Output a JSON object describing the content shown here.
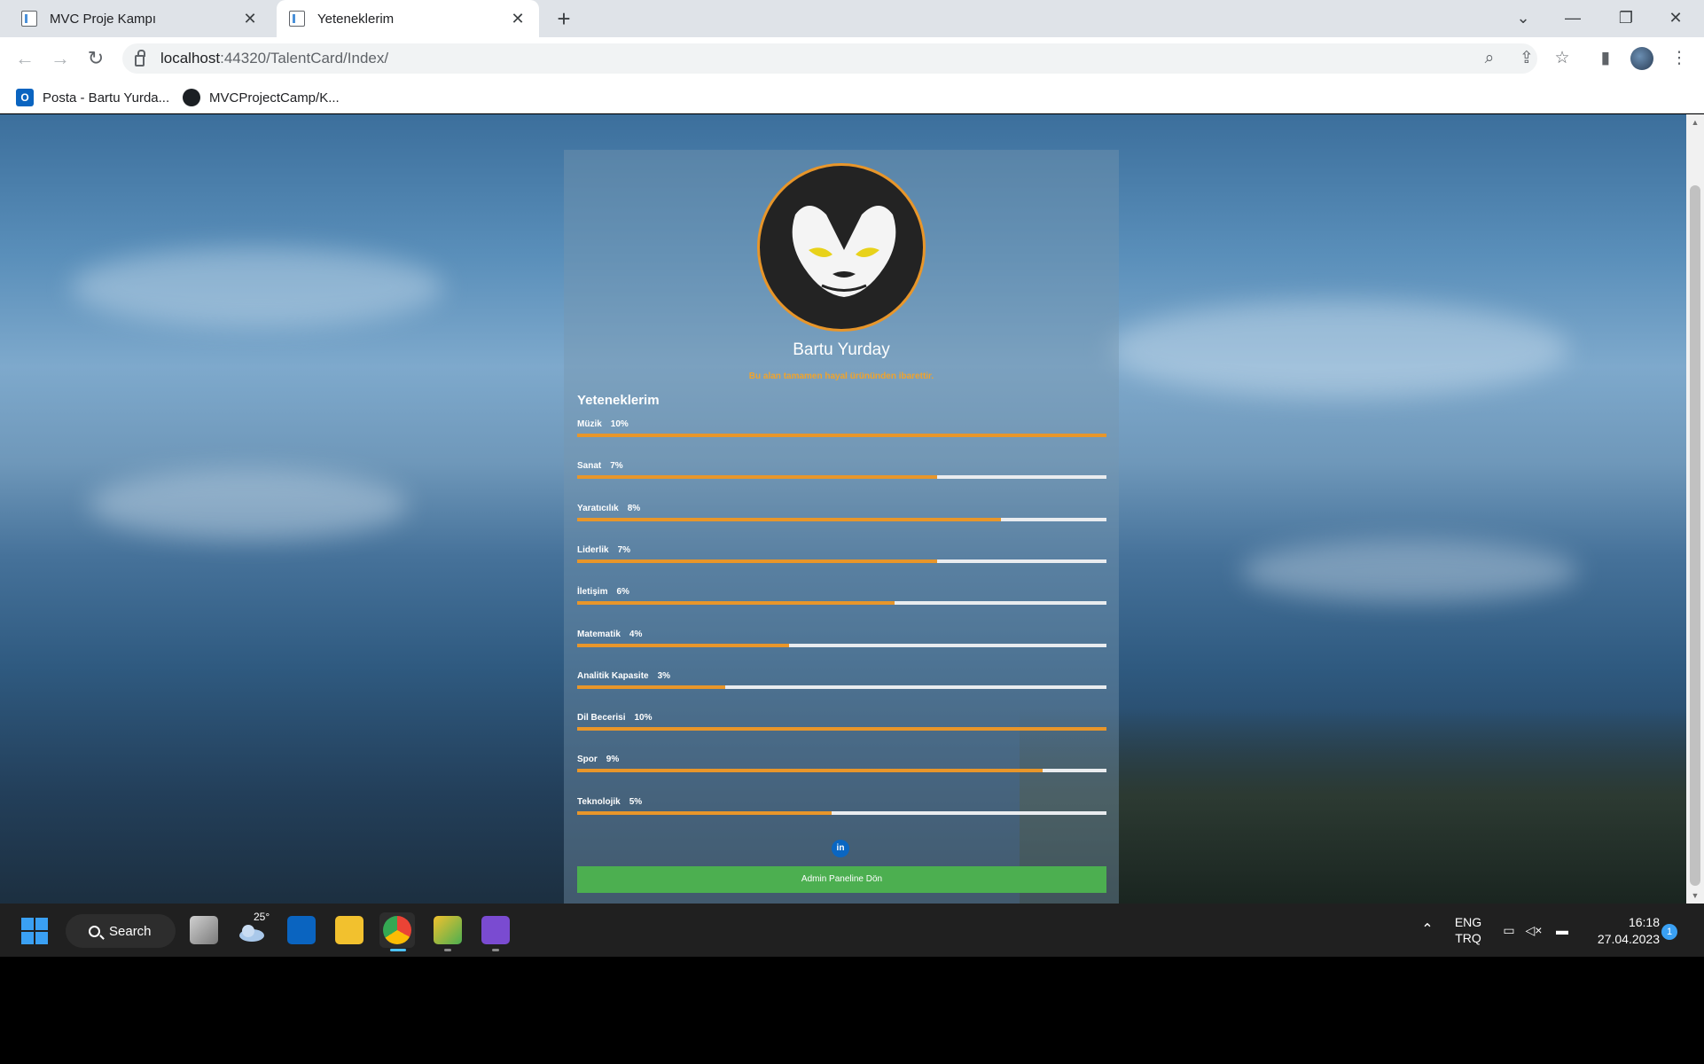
{
  "browser": {
    "tabs": [
      {
        "title": "MVC Proje Kampı",
        "close": "✕"
      },
      {
        "title": "Yeteneklerim",
        "close": "✕"
      }
    ],
    "new_tab": "+",
    "url_host": "localhost",
    "url_path": ":44320/TalentCard/Index/",
    "bookmarks": [
      {
        "label": "Posta - Bartu Yurda...",
        "icon": "outlook-icon"
      },
      {
        "label": "MVCProjectCamp/K...",
        "icon": "github-icon"
      }
    ]
  },
  "card": {
    "name": "Bartu Yurday",
    "description": "Bu alan tamamen hayal ürününden ibarettir.",
    "skills_title": "Yeteneklerim",
    "skills": [
      {
        "name": "Müzik",
        "percent_label": "10%",
        "fill": 1.0
      },
      {
        "name": "Sanat",
        "percent_label": "7%",
        "fill": 0.68
      },
      {
        "name": "Yaratıcılık",
        "percent_label": "8%",
        "fill": 0.8
      },
      {
        "name": "Liderlik",
        "percent_label": "7%",
        "fill": 0.68
      },
      {
        "name": "İletişim",
        "percent_label": "6%",
        "fill": 0.6
      },
      {
        "name": "Matematik",
        "percent_label": "4%",
        "fill": 0.4
      },
      {
        "name": "Analitik Kapasite",
        "percent_label": "3%",
        "fill": 0.28
      },
      {
        "name": "Dil Becerisi",
        "percent_label": "10%",
        "fill": 1.0
      },
      {
        "name": "Spor",
        "percent_label": "9%",
        "fill": 0.88
      },
      {
        "name": "Teknolojik",
        "percent_label": "5%",
        "fill": 0.48
      }
    ],
    "linkedin_label": "in",
    "admin_button": "Admin Paneline Dön"
  },
  "colors": {
    "accent": "#e8962a",
    "track": "#e9ecef",
    "button": "#4caf50",
    "linkedin": "#0a66c2"
  },
  "taskbar": {
    "search_label": "Search",
    "weather_temp": "25°",
    "lang_top": "ENG",
    "lang_bottom": "TRQ",
    "time": "16:18",
    "date": "27.04.2023",
    "notification_count": "1"
  }
}
